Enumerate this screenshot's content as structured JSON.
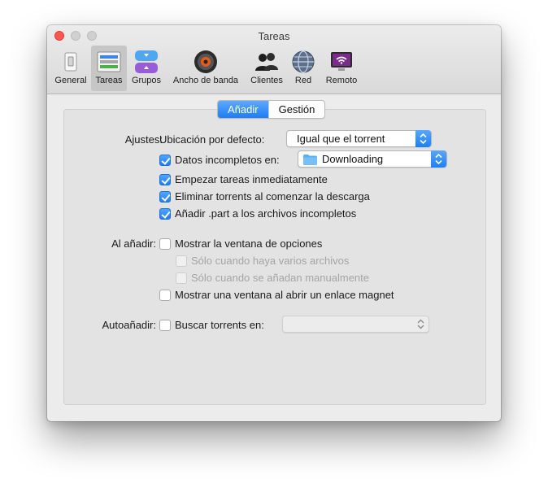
{
  "window": {
    "title": "Tareas"
  },
  "toolbar": {
    "items": [
      {
        "label": "General",
        "icon": "switch-icon"
      },
      {
        "label": "Tareas",
        "icon": "tasks-list-icon",
        "selected": true
      },
      {
        "label": "Grupos",
        "icon": "groups-icon"
      },
      {
        "label": "Ancho de banda",
        "icon": "speedometer-icon"
      },
      {
        "label": "Clientes",
        "icon": "users-icon"
      },
      {
        "label": "Red",
        "icon": "globe-icon"
      },
      {
        "label": "Remoto",
        "icon": "remote-monitor-icon"
      }
    ]
  },
  "tabs": {
    "add": "Añadir",
    "manage": "Gestión",
    "active": "Añadir"
  },
  "settings": {
    "ajustes_label": "Ajustes:",
    "default_location_label": "Ubicación por defecto:",
    "default_location_value": "Igual que el torrent",
    "incomplete_label": "Datos incompletos en:",
    "incomplete_checked": true,
    "incomplete_folder": "Downloading",
    "start_tasks_label": "Empezar tareas inmediatamente",
    "start_tasks_checked": true,
    "remove_torrents_label": "Eliminar torrents al comenzar la descarga",
    "remove_torrents_checked": true,
    "add_part_label": "Añadir .part a los archivos incompletos",
    "add_part_checked": true
  },
  "on_add": {
    "label": "Al añadir:",
    "show_options_label": "Mostrar la ventana de opciones",
    "show_options_checked": false,
    "multiple_files_label": "Sólo cuando haya varios archivos",
    "manual_label": "Sólo cuando se añadan manualmente",
    "magnet_label": "Mostrar una ventana al abrir un enlace magnet",
    "magnet_checked": false
  },
  "auto_add": {
    "label": "Autoañadir:",
    "search_label": "Buscar torrents en:",
    "search_checked": false,
    "folder_value": ""
  },
  "colors": {
    "accent": "#1b7ef6",
    "close": "#fc5753"
  }
}
